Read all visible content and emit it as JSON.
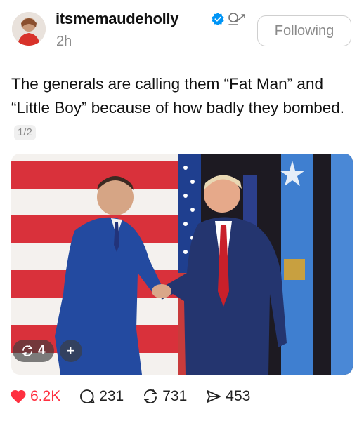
{
  "post": {
    "username": "itsmemaudeholly",
    "time": "2h",
    "follow_label": "Following",
    "text": "The generals are calling them “Fat Man” and “Little Boy” because of how badly they bombed.",
    "page_counter": "1/2",
    "media": {
      "overlay_count": "4",
      "overlay_plus": "+"
    },
    "stats": {
      "likes": "6.2K",
      "comments": "231",
      "reposts": "731",
      "shares": "453"
    }
  },
  "colors": {
    "like": "#ff3040",
    "verified": "#0095f6",
    "muted": "#8a8a8a"
  },
  "icons": [
    "verified-badge-icon",
    "creator-icon",
    "heart-icon",
    "comment-icon",
    "repost-icon",
    "share-icon"
  ]
}
